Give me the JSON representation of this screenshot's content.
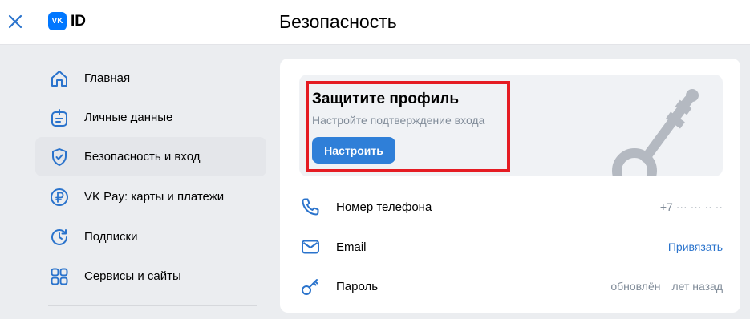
{
  "header": {
    "title": "Безопасность",
    "logo_mark": "VK",
    "logo_text": "ID"
  },
  "sidebar": {
    "items": [
      {
        "label": "Главная",
        "icon": "home-icon"
      },
      {
        "label": "Личные данные",
        "icon": "personal-data-icon"
      },
      {
        "label": "Безопасность и вход",
        "icon": "shield-icon",
        "active": true
      },
      {
        "label": "VK Pay: карты и платежи",
        "icon": "ruble-icon"
      },
      {
        "label": "Подписки",
        "icon": "subscriptions-icon"
      },
      {
        "label": "Сервисы и сайты",
        "icon": "services-icon"
      }
    ]
  },
  "promo": {
    "title": "Защитите профиль",
    "subtitle": "Настройте подтверждение входа",
    "button_label": "Настроить"
  },
  "security_rows": [
    {
      "label": "Номер телефона",
      "value": "+7 ··· ··· ·· ··",
      "icon": "phone-icon"
    },
    {
      "label": "Email",
      "value": "Привязать",
      "icon": "mail-icon"
    },
    {
      "label": "Пароль",
      "value_a": "обновлён",
      "value_b": "лет назад",
      "icon": "key-icon"
    }
  ],
  "colors": {
    "accent": "#2f7fd8",
    "link": "#2a73cc",
    "highlight_outline": "#e51c23",
    "active_item_bg": "#e4e6ea"
  }
}
